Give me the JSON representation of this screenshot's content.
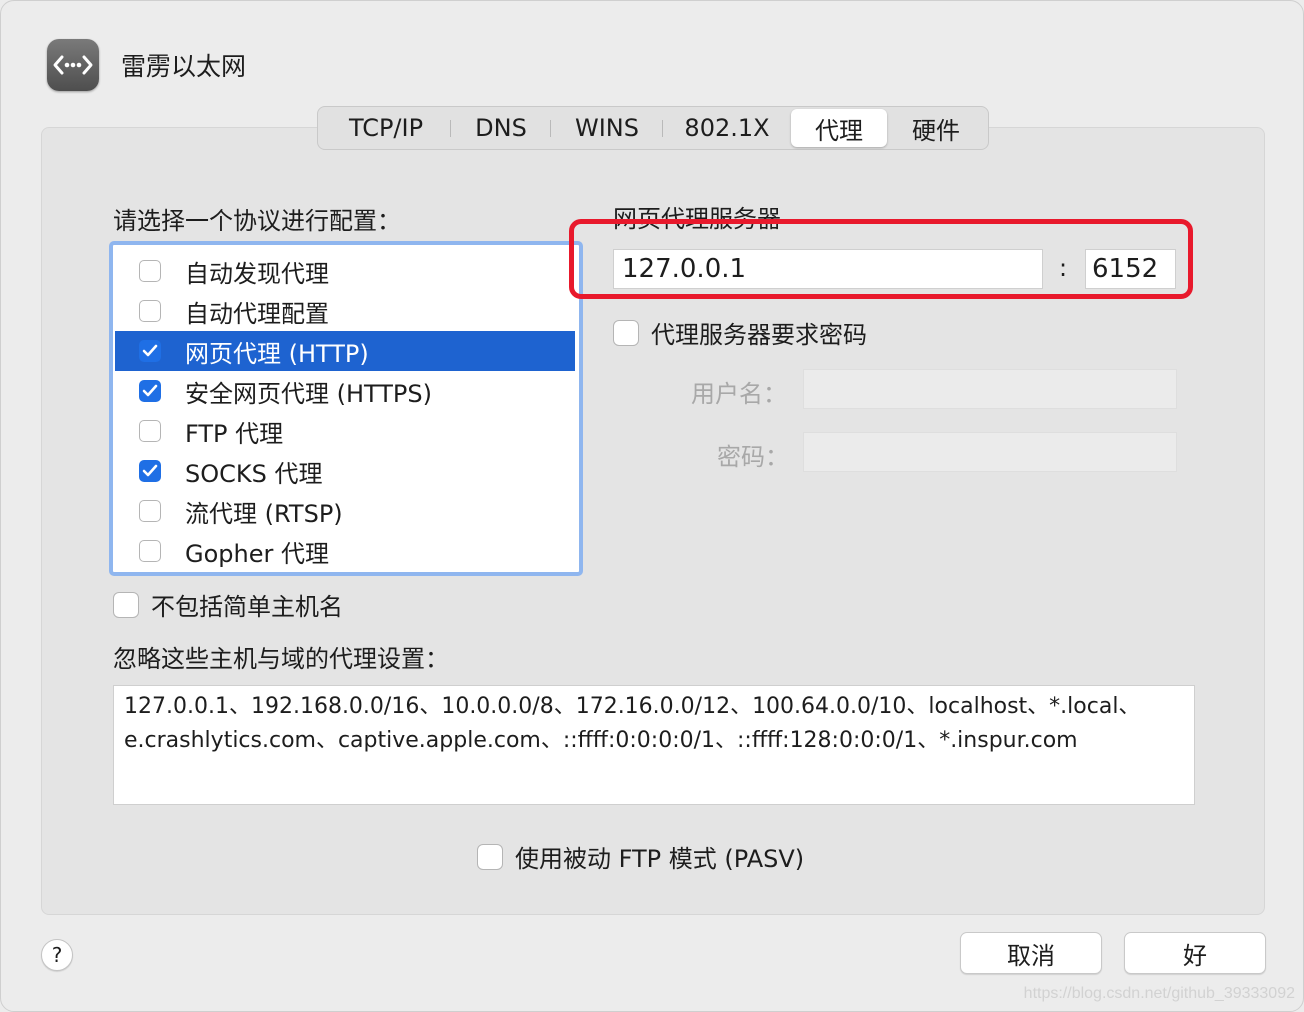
{
  "window": {
    "title": "雷雳以太网",
    "icon": "network-ethernet-icon"
  },
  "tabs": [
    {
      "label": "TCP/IP",
      "active": false
    },
    {
      "label": "DNS",
      "active": false
    },
    {
      "label": "WINS",
      "active": false
    },
    {
      "label": "802.1X",
      "active": false
    },
    {
      "label": "代理",
      "active": true
    },
    {
      "label": "硬件",
      "active": false
    }
  ],
  "protocols": {
    "heading": "请选择一个协议进行配置：",
    "items": [
      {
        "label": "自动发现代理",
        "checked": false,
        "selected": false
      },
      {
        "label": "自动代理配置",
        "checked": false,
        "selected": false
      },
      {
        "label": "网页代理 (HTTP)",
        "checked": true,
        "selected": true
      },
      {
        "label": "安全网页代理 (HTTPS)",
        "checked": true,
        "selected": false
      },
      {
        "label": "FTP 代理",
        "checked": false,
        "selected": false
      },
      {
        "label": "SOCKS 代理",
        "checked": true,
        "selected": false
      },
      {
        "label": "流代理 (RTSP)",
        "checked": false,
        "selected": false
      },
      {
        "label": "Gopher 代理",
        "checked": false,
        "selected": false
      }
    ]
  },
  "server": {
    "heading": "网页代理服务器",
    "host": "127.0.0.1",
    "separator": ":",
    "port": "6152",
    "require_password_label": "代理服务器要求密码",
    "require_password_checked": false,
    "username_label": "用户名：",
    "username_value": "",
    "password_label": "密码：",
    "password_value": ""
  },
  "exclude_simple_hostnames": {
    "label": "不包括简单主机名",
    "checked": false
  },
  "bypass": {
    "heading": "忽略这些主机与域的代理设置：",
    "lines": [
      "127.0.0.1、192.168.0.0/16、10.0.0.0/8、172.16.0.0/12、100.64.0.0/10、localhost、*.local、",
      "e.crashlytics.com、captive.apple.com、::ffff:0:0:0:0/1、::ffff:128:0:0:0/1、*.inspur.com"
    ]
  },
  "pasv": {
    "label": "使用被动 FTP 模式 (PASV)",
    "checked": false
  },
  "footer": {
    "help_label": "?",
    "cancel_label": "取消",
    "ok_label": "好"
  },
  "watermark": "https://blog.csdn.net/github_39333092",
  "colors": {
    "selection": "#1e63d0",
    "checkbox_checked": "#1f6fe5",
    "list_focus_ring": "#8fb6ef",
    "annotation_red": "#e8192c"
  }
}
